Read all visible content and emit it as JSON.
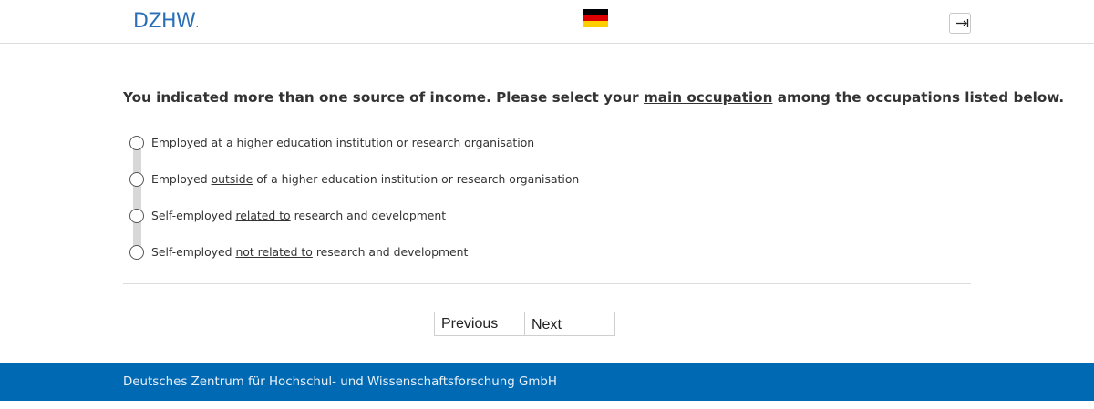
{
  "header": {
    "logo_text": "DZHW",
    "logo_dot": ".",
    "language_flag_icon": "germany-flag-icon",
    "logout_icon": "logout-icon"
  },
  "question": {
    "part1": "You indicated more than one source of income. Please select your ",
    "emphasis": "main occupation",
    "part2": " among the occupations listed below."
  },
  "options": [
    {
      "pre": "Employed ",
      "u": "at",
      "post": " a higher education institution or research organisation",
      "selected": false
    },
    {
      "pre": "Employed ",
      "u": "outside",
      "post": " of a higher education institution or research organisation",
      "selected": false
    },
    {
      "pre": "Self-employed ",
      "u": "related to",
      "post": " research and development",
      "selected": false
    },
    {
      "pre": "Self-employed ",
      "u": "not related to",
      "post": " research and development",
      "selected": false
    }
  ],
  "navigation": {
    "previous_label": "Previous",
    "next_label": "Next"
  },
  "footer": {
    "text": "Deutsches Zentrum für Hochschul- und Wissenschaftsforschung GmbH"
  },
  "colors": {
    "brand_blue": "#0069b4",
    "logo_blue": "#2a6fb6",
    "flag_black": "#000000",
    "flag_red": "#dd0000",
    "flag_gold": "#ffce00"
  }
}
